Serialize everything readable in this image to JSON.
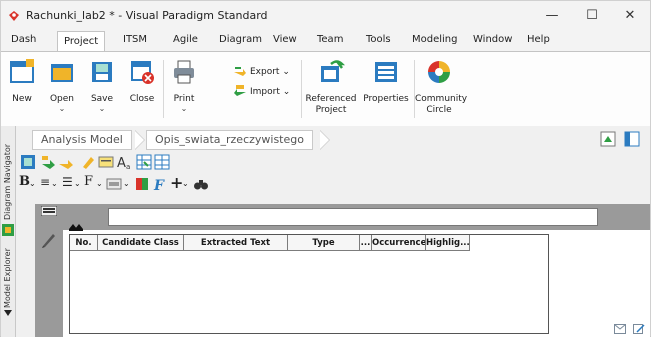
{
  "window": {
    "title": "Rachunki_lab2 * - Visual Paradigm Standard",
    "controls": {
      "minimize": "—",
      "maximize": "☐",
      "close": "✕"
    }
  },
  "menu": [
    "Dash",
    "Project",
    "ITSM",
    "Agile",
    "Diagram",
    "View",
    "Team",
    "Tools",
    "Modeling",
    "Window",
    "Help"
  ],
  "menu_active": "Project",
  "ribbon": {
    "new": "New",
    "open": "Open",
    "save": "Save",
    "close": "Close",
    "print": "Print",
    "export": "Export",
    "import": "Import",
    "referenced_project": "Referenced Project",
    "properties": "Properties",
    "community_circle": "Community Circle",
    "dropdown": "⌄"
  },
  "side_tabs": {
    "diagram_navigator": "Diagram Navigator",
    "model_explorer": "Model Explorer"
  },
  "breadcrumb": [
    "Analysis Model",
    "Opis_swiata_rzeczywistego"
  ],
  "format_toolbar": {
    "bold": "B",
    "align": "≡",
    "list": "☰",
    "font": "F",
    "plus": "+"
  },
  "table": {
    "columns": [
      "No.",
      "Candidate Class",
      "Extracted Text",
      "Type",
      "...",
      "Occurrence",
      "Highlig..."
    ]
  },
  "colors": {
    "accent_red": "#d9332a",
    "ribbon_blue": "#2b7bc0",
    "green": "#2f9e44",
    "gray_canvas": "#9a9a9a"
  }
}
